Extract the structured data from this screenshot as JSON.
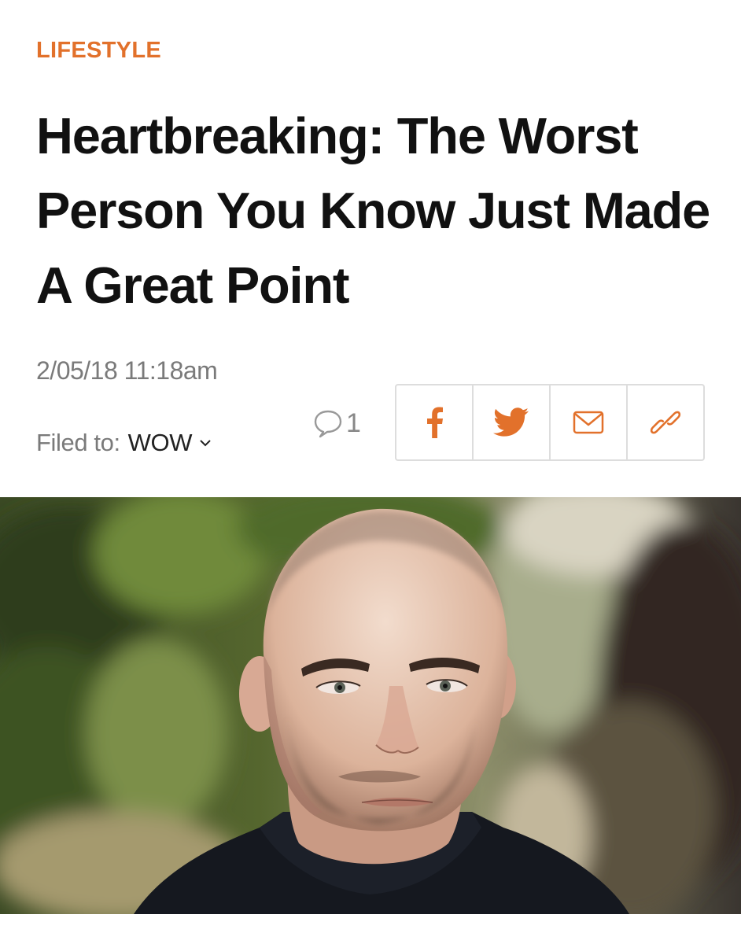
{
  "article": {
    "category": "LIFESTYLE",
    "headline": "Heartbreaking: The Worst Person You Know Just Made A Great Point",
    "timestamp": "2/05/18 11:18am",
    "filed_label": "Filed to:",
    "filed_tag": "WOW",
    "comment_count": "1"
  },
  "share": {
    "buttons": [
      {
        "name": "facebook",
        "icon": "facebook-icon"
      },
      {
        "name": "twitter",
        "icon": "twitter-icon"
      },
      {
        "name": "email",
        "icon": "email-icon"
      },
      {
        "name": "link",
        "icon": "link-icon"
      }
    ]
  },
  "hero_image": {
    "subject": "portrait photo of a bald man with stubble in front of blurred green foliage"
  },
  "colors": {
    "accent": "#e2712b",
    "headline": "#111111",
    "meta": "#7a7a7a",
    "border": "#dddddd"
  }
}
